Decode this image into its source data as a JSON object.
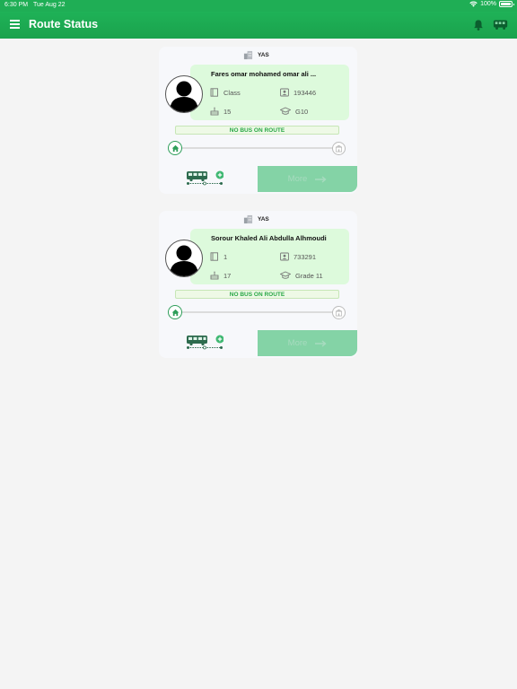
{
  "status_bar": {
    "time": "6:30 PM",
    "date": "Tue Aug 22",
    "battery": "100%",
    "battery_level": 1.0
  },
  "app_bar": {
    "title": "Route Status"
  },
  "students": [
    {
      "org": "YAS",
      "name": "Fares omar mohamed omar ali ...",
      "class_label": "Class",
      "id_number": "193446",
      "age": "15",
      "grade": "G10",
      "bus_status": "NO BUS ON ROUTE",
      "more_label": "More"
    },
    {
      "org": "YAS",
      "name": "Sorour Khaled Ali Abdulla Alhmoudi",
      "class_label": "1",
      "id_number": "733291",
      "age": "17",
      "grade": "Grade 11",
      "bus_status": "NO BUS ON ROUTE",
      "more_label": "More"
    }
  ],
  "colors": {
    "primary": "#1fae55",
    "card_info_bg": "#ddfadc",
    "more_button": "#84d3a6",
    "status_text": "#28a745"
  }
}
